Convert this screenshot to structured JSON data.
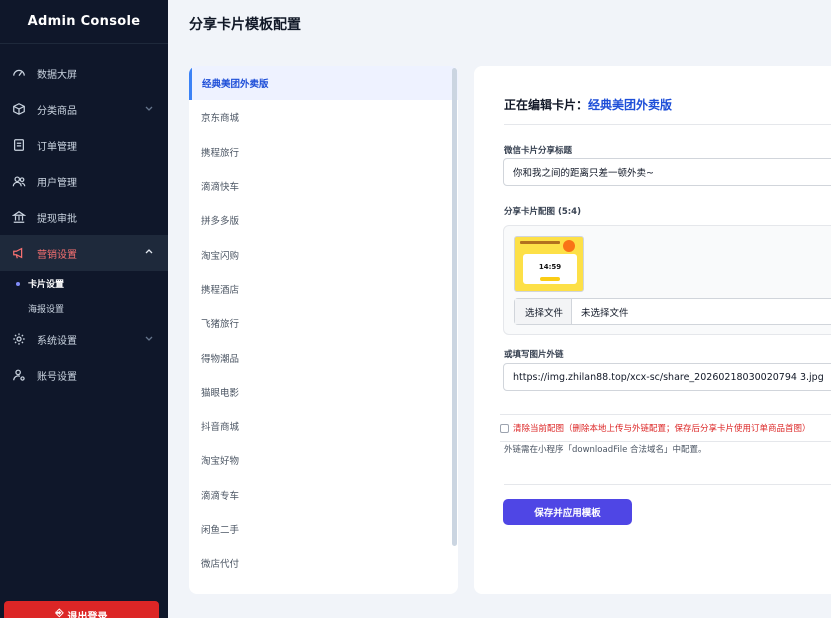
{
  "app": {
    "title": "Admin Console"
  },
  "sidebar": {
    "items": [
      {
        "label": "数据大屏",
        "icon": "dashboard-icon"
      },
      {
        "label": "分类商品",
        "icon": "box-icon",
        "has_chevron": true
      },
      {
        "label": "订单管理",
        "icon": "receipt-icon"
      },
      {
        "label": "用户管理",
        "icon": "users-icon"
      },
      {
        "label": "提现审批",
        "icon": "bank-icon"
      },
      {
        "label": "营销设置",
        "icon": "megaphone-icon",
        "has_chevron": true,
        "expanded": true,
        "active": true
      },
      {
        "label": "系统设置",
        "icon": "gear-icon",
        "has_chevron": true
      },
      {
        "label": "账号设置",
        "icon": "user-gear-icon"
      }
    ],
    "subitems": [
      {
        "label": "卡片设置",
        "active": true
      },
      {
        "label": "海报设置",
        "active": false
      }
    ],
    "logout_label": "退出登录"
  },
  "page": {
    "title": "分享卡片模板配置"
  },
  "templates": [
    "经典美团外卖版",
    "京东商城",
    "携程旅行",
    "滴滴快车",
    "拼多多版",
    "淘宝闪购",
    "携程酒店",
    "飞猪旅行",
    "得物潮品",
    "猫眼电影",
    "抖音商城",
    "淘宝好物",
    "滴滴专车",
    "闲鱼二手",
    "微店代付"
  ],
  "editor": {
    "heading_prefix": "正在编辑卡片：",
    "heading_name": "经典美团外卖版",
    "share_title_label": "微信卡片分享标题",
    "share_title_value": "你和我之间的距离只差一顿外卖~",
    "image_label": "分享卡片配图 (5:4)",
    "thumbnail_time": "14:59",
    "choose_file_label": "选择文件",
    "file_status": "未选择文件",
    "url_label": "或填写图片外链",
    "url_value": "https://img.zhilan88.top/xcx-sc/share_20260218030020794 3.jpg",
    "clear_label": "清除当前配图（删除本地上传与外链配置；保存后分享卡片使用订单商品首图）",
    "hint": "外链需在小程序「downloadFile 合法域名」中配置。",
    "save_label": "保存并应用模板"
  },
  "colors": {
    "sidebar_bg": "#0f172a",
    "accent": "#4f46e5",
    "active_nav": "#f87171",
    "danger": "#dc2626",
    "link": "#1d4ed8"
  }
}
